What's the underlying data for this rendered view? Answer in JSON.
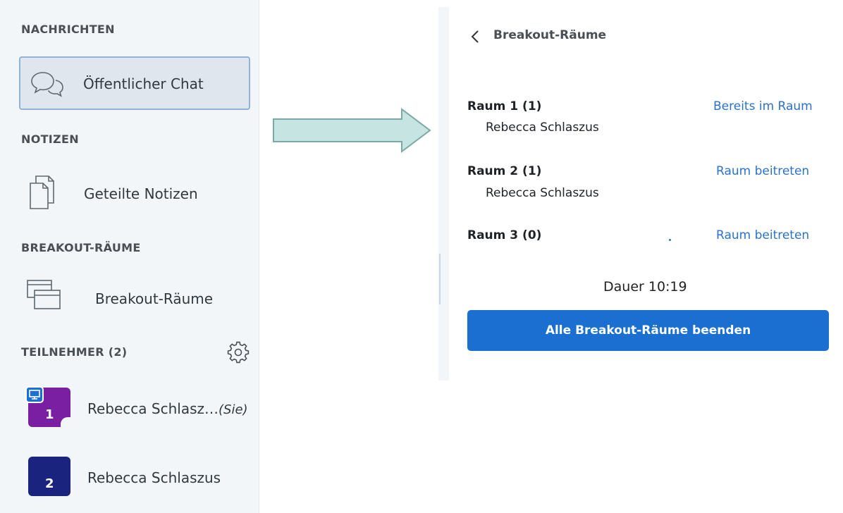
{
  "sidebar": {
    "messages_title": "NACHRICHTEN",
    "public_chat_label": "Öffentlicher Chat",
    "notes_title": "NOTIZEN",
    "shared_notes_label": "Geteilte Notizen",
    "breakout_title": "BREAKOUT-RÄUME",
    "breakout_item_label": "Breakout-Räume",
    "participants_title": "TEILNEHMER (2)",
    "participants": [
      {
        "avatar_number": "1",
        "name": "Rebecca Schlasz…",
        "suffix": "(Sie)",
        "avatar_color": "#7b1fa2",
        "presenter": true
      },
      {
        "avatar_number": "2",
        "name": "Rebecca Schlaszus",
        "suffix": "",
        "avatar_color": "#1a237e",
        "presenter": false
      }
    ]
  },
  "panel": {
    "back_label": "Breakout-Räume",
    "rooms": [
      {
        "name": "Raum 1 (1)",
        "member": "Rebecca Schlaszus",
        "action": "Bereits im Raum"
      },
      {
        "name": "Raum 2 (1)",
        "member": "Rebecca Schlaszus",
        "action": "Raum beitreten"
      },
      {
        "name": "Raum 3 (0)",
        "member": "",
        "action": "Raum beitreten"
      }
    ],
    "duration": "Dauer 10:19",
    "end_all_button": "Alle Breakout-Räume beenden"
  },
  "colors": {
    "accent": "#1a6fd0",
    "link": "#2b72c8",
    "arrow_fill": "#c5e4e2",
    "arrow_stroke": "#7aa9a6"
  },
  "icons": [
    "chat-icon",
    "notes-icon",
    "breakout-icon",
    "gear-icon",
    "presenter-icon",
    "back-chevron-icon",
    "arrow-icon"
  ]
}
